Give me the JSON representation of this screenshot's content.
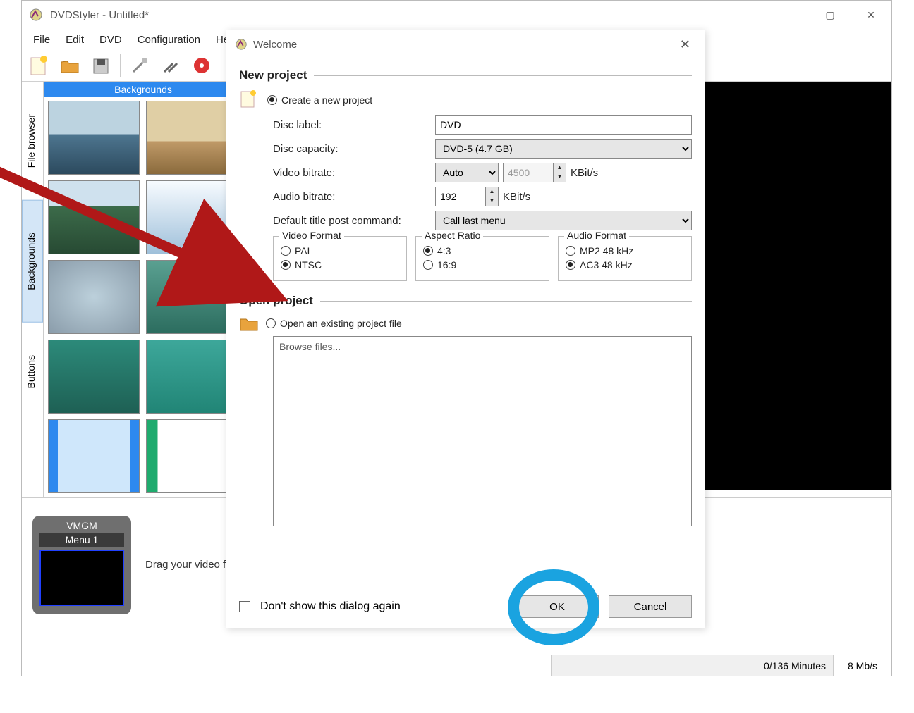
{
  "app": {
    "title": "DVDStyler - Untitled*",
    "menu": [
      "File",
      "Edit",
      "DVD",
      "Configuration",
      "Help"
    ]
  },
  "sidetabs": {
    "file_browser": "File browser",
    "backgrounds": "Backgrounds",
    "buttons": "Buttons"
  },
  "bg_panel_title": "Backgrounds",
  "vmgm": {
    "head": "VMGM",
    "menu": "Menu 1"
  },
  "drag_text": "Drag your video files here",
  "status": {
    "minutes": "0/136 Minutes",
    "bitrate": "8 Mb/s"
  },
  "dialog": {
    "title": "Welcome",
    "new_project": "New project",
    "create_new": "Create a new project",
    "disc_label_lbl": "Disc label:",
    "disc_label_val": "DVD",
    "disc_capacity_lbl": "Disc capacity:",
    "disc_capacity_val": "DVD-5 (4.7 GB)",
    "video_bitrate_lbl": "Video bitrate:",
    "video_bitrate_mode": "Auto",
    "video_bitrate_val": "4500",
    "kbits": "KBit/s",
    "audio_bitrate_lbl": "Audio bitrate:",
    "audio_bitrate_val": "192",
    "post_cmd_lbl": "Default title post command:",
    "post_cmd_val": "Call last menu",
    "video_format": "Video Format",
    "pal": "PAL",
    "ntsc": "NTSC",
    "aspect_ratio": "Aspect Ratio",
    "ar43": "4:3",
    "ar169": "16:9",
    "audio_format": "Audio Format",
    "mp2": "MP2 48 kHz",
    "ac3": "AC3 48 kHz",
    "open_project": "Open project",
    "open_existing": "Open an existing project file",
    "browse": "Browse files...",
    "dont_show": "Don't show this dialog again",
    "ok": "OK",
    "cancel": "Cancel"
  }
}
